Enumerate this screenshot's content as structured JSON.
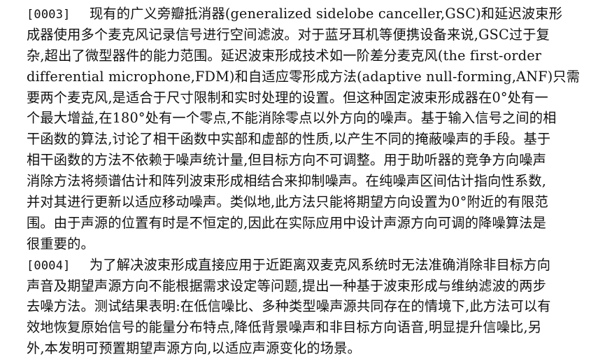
{
  "paragraphs": [
    {
      "id": "[0003]",
      "lines": [
        "现有的广义旁瓣抵消器(generalized sidelobe canceller,GSC)和延迟波束形",
        "成器使用多个麦克风记录信号进行空间滤波。对于蓝牙耳机等便携设备来说,GSC过于复",
        "杂,超出了微型器件的能力范围。延迟波束形成技术如一阶差分麦克风(the first-order",
        "differential microphone,FDM)和自适应零形成方法(adaptive null-forming,ANF)只需",
        "要两个麦克风,是适合于尺寸限制和实时处理的设置。但这种固定波束形成器在0°处有一",
        "个最大增益,在180°处有一个零点,不能消除零点以外方向的噪声。基于输入信号之间的相",
        "干函数的算法,讨论了相干函数中实部和虚部的性质,以产生不同的掩蔽噪声的手段。基于",
        "相干函数的方法不依赖于噪声统计量,但目标方向不可调整。用于助听器的竞争方向噪声",
        "消除方法将频谱估计和阵列波束形成相结合来抑制噪声。在纯噪声区间估计指向性系数,",
        "并对其进行更新以适应移动噪声。类似地,此方法只能将期望方向设置为0°附近的有限范",
        "围。由于声源的位置有时是不恒定的,因此在实际应用中设计声源方向可调的降噪算法是",
        "很重要的。"
      ]
    },
    {
      "id": "[0004]",
      "lines": [
        "为了解决波束形成直接应用于近距离双麦克风系统时无法准确消除非目标方向",
        "声音及期望声源方向不能根据需求设定等问题,提出一种基于波束形成与维纳滤波的两步",
        "去噪方法。测试结果表明:在低信噪比、多种类型噪声源共同存在的情境下,此方法可以有",
        "效地恢复原始信号的能量分布特点,降低背景噪声和非目标方向语音,明显提升信噪比,另",
        "外,本发明可预置期望声源方向,以适应声源变化的场景。"
      ]
    }
  ]
}
